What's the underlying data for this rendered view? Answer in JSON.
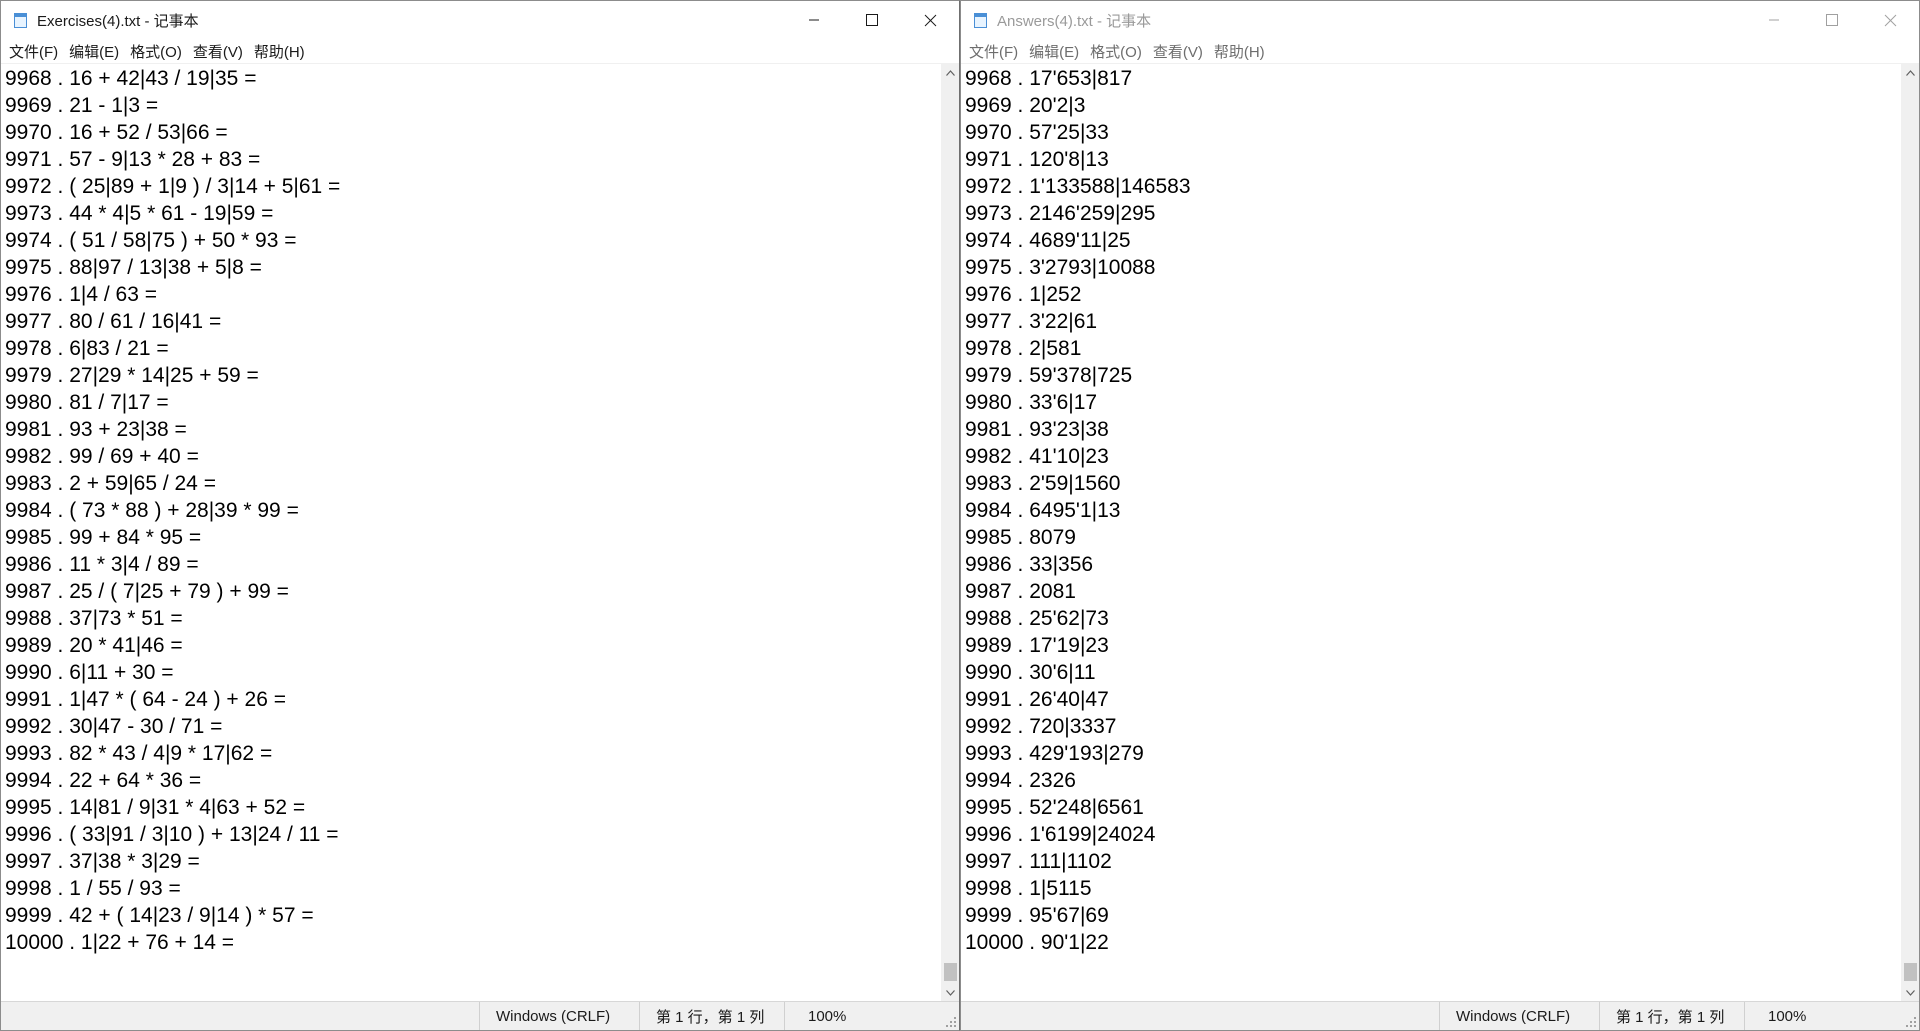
{
  "windows": [
    {
      "title": "Exercises(4).txt - 记事本",
      "active": true,
      "menu": [
        "文件(F)",
        "编辑(E)",
        "格式(O)",
        "查看(V)",
        "帮助(H)"
      ],
      "lines": [
        "9968 . 16 + 42|43 / 19|35 =",
        "9969 . 21 - 1|3 =",
        "9970 . 16 + 52 / 53|66 =",
        "9971 . 57 - 9|13 * 28 + 83 =",
        "9972 . ( 25|89 + 1|9 ) / 3|14 + 5|61 =",
        "9973 . 44 * 4|5 * 61 - 19|59 =",
        "9974 . ( 51 / 58|75 ) + 50 * 93 =",
        "9975 . 88|97 / 13|38 + 5|8 =",
        "9976 . 1|4 / 63 =",
        "9977 . 80 / 61 / 16|41 =",
        "9978 . 6|83 / 21 =",
        "9979 . 27|29 * 14|25 + 59 =",
        "9980 . 81 / 7|17 =",
        "9981 . 93 + 23|38 =",
        "9982 . 99 / 69 + 40 =",
        "9983 . 2 + 59|65 / 24 =",
        "9984 . ( 73 * 88 ) + 28|39 * 99 =",
        "9985 . 99 + 84 * 95 =",
        "9986 . 11 * 3|4 / 89 =",
        "9987 . 25 / ( 7|25 + 79 ) + 99 =",
        "9988 . 37|73 * 51 =",
        "9989 . 20 * 41|46 =",
        "9990 . 6|11 + 30 =",
        "9991 . 1|47 * ( 64 - 24 ) + 26 =",
        "9992 . 30|47 - 30 / 71 =",
        "9993 . 82 * 43 / 4|9 * 17|62 =",
        "9994 . 22 + 64 * 36 =",
        "9995 . 14|81 / 9|31 * 4|63 + 52 =",
        "9996 . ( 33|91 / 3|10 ) + 13|24 / 11 =",
        "9997 . 37|38 * 3|29 =",
        "9998 . 1 / 55 / 93 =",
        "9999 . 42 + ( 14|23 / 9|14 ) * 57 =",
        "10000 . 1|22 + 76 + 14 ="
      ],
      "status": {
        "encoding": "Windows (CRLF)",
        "position": "第 1 行，第 1 列",
        "zoom": "100%"
      }
    },
    {
      "title": "Answers(4).txt - 记事本",
      "active": false,
      "menu": [
        "文件(F)",
        "编辑(E)",
        "格式(O)",
        "查看(V)",
        "帮助(H)"
      ],
      "lines": [
        "9968 . 17'653|817",
        "9969 . 20'2|3",
        "9970 . 57'25|33",
        "9971 . 120'8|13",
        "9972 . 1'133588|146583",
        "9973 . 2146'259|295",
        "9974 . 4689'11|25",
        "9975 . 3'2793|10088",
        "9976 . 1|252",
        "9977 . 3'22|61",
        "9978 . 2|581",
        "9979 . 59'378|725",
        "9980 . 33'6|17",
        "9981 . 93'23|38",
        "9982 . 41'10|23",
        "9983 . 2'59|1560",
        "9984 . 6495'1|13",
        "9985 . 8079",
        "9986 . 33|356",
        "9987 . 2081",
        "9988 . 25'62|73",
        "9989 . 17'19|23",
        "9990 . 30'6|11",
        "9991 . 26'40|47",
        "9992 . 720|3337",
        "9993 . 429'193|279",
        "9994 . 2326",
        "9995 . 52'248|6561",
        "9996 . 1'6199|24024",
        "9997 . 111|1102",
        "9998 . 1|5115",
        "9999 . 95'67|69",
        "10000 . 90'1|22"
      ],
      "status": {
        "encoding": "Windows (CRLF)",
        "position": "第 1 行，第 1 列",
        "zoom": "100%"
      }
    }
  ],
  "icons": {
    "app": "notepad-icon",
    "minimize": "minimize-icon",
    "maximize": "maximize-icon",
    "close": "close-icon",
    "scroll_up": "chevron-up-icon",
    "scroll_down": "chevron-down-icon",
    "grip": "resize-grip-icon"
  },
  "colors": {
    "active_title": "#1a1a1a",
    "inactive_title": "#9a9a9a",
    "status_bg": "#f0f0f0",
    "text": "#000000"
  }
}
